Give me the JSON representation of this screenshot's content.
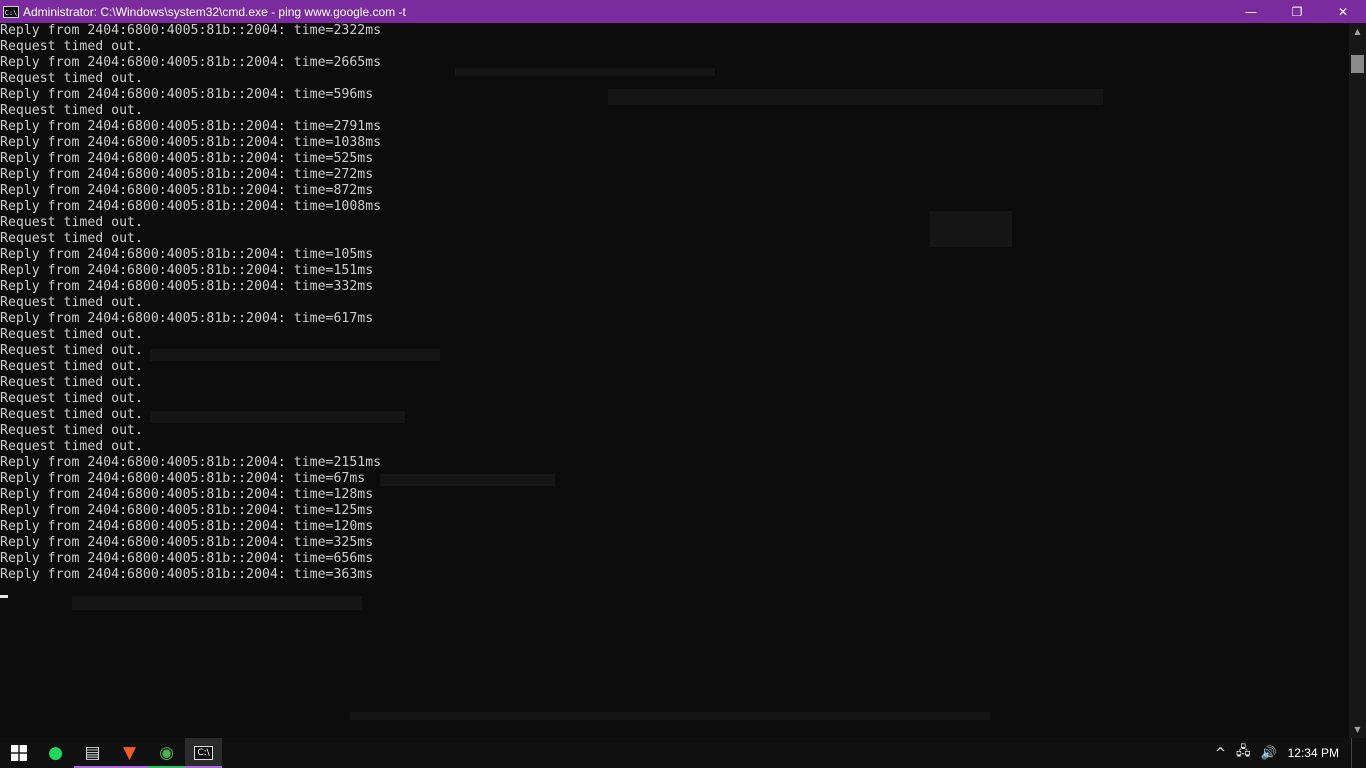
{
  "window": {
    "title": "Administrator: C:\\Windows\\system32\\cmd.exe - ping  www.google.com -t",
    "icon": "cmd-icon",
    "icon_glyph": "C:\\",
    "controls": {
      "minimize": "—",
      "restore": "❐",
      "close": "✕"
    }
  },
  "console": {
    "lines": [
      "Reply from 2404:6800:4005:81b::2004: time=2322ms",
      "Request timed out.",
      "Reply from 2404:6800:4005:81b::2004: time=2665ms",
      "Request timed out.",
      "Reply from 2404:6800:4005:81b::2004: time=596ms",
      "Request timed out.",
      "Reply from 2404:6800:4005:81b::2004: time=2791ms",
      "Reply from 2404:6800:4005:81b::2004: time=1038ms",
      "Reply from 2404:6800:4005:81b::2004: time=525ms",
      "Reply from 2404:6800:4005:81b::2004: time=272ms",
      "Reply from 2404:6800:4005:81b::2004: time=872ms",
      "Reply from 2404:6800:4005:81b::2004: time=1008ms",
      "Request timed out.",
      "Request timed out.",
      "Reply from 2404:6800:4005:81b::2004: time=105ms",
      "Reply from 2404:6800:4005:81b::2004: time=151ms",
      "Reply from 2404:6800:4005:81b::2004: time=332ms",
      "Request timed out.",
      "Reply from 2404:6800:4005:81b::2004: time=617ms",
      "Request timed out.",
      "Request timed out.",
      "Request timed out.",
      "Request timed out.",
      "Request timed out.",
      "Request timed out.",
      "Request timed out.",
      "Request timed out.",
      "Reply from 2404:6800:4005:81b::2004: time=2151ms",
      "Reply from 2404:6800:4005:81b::2004: time=67ms",
      "Reply from 2404:6800:4005:81b::2004: time=128ms",
      "Reply from 2404:6800:4005:81b::2004: time=125ms",
      "Reply from 2404:6800:4005:81b::2004: time=120ms",
      "Reply from 2404:6800:4005:81b::2004: time=325ms",
      "Reply from 2404:6800:4005:81b::2004: time=656ms",
      "Reply from 2404:6800:4005:81b::2004: time=363ms"
    ]
  },
  "scrollbar": {
    "up": "▲",
    "down": "▼"
  },
  "taskbar": {
    "start": "windows-icon",
    "apps": [
      {
        "name": "spotify-icon",
        "glyph": "●",
        "color": "#1ed760",
        "active": false,
        "running": false
      },
      {
        "name": "file-manager-icon",
        "glyph": "▤",
        "color": "#cfd8dc",
        "active": false,
        "running": true
      },
      {
        "name": "brave-browser-icon",
        "glyph": "▼",
        "color": "#f25a29",
        "active": false,
        "running": true
      },
      {
        "name": "chrome-icon",
        "glyph": "◉",
        "color": "#4caf50",
        "active": false,
        "running": true
      },
      {
        "name": "cmd-icon",
        "glyph": "C:\\",
        "color": "#ffffff",
        "active": true,
        "running": true
      }
    ],
    "tray": {
      "chevron": "^",
      "network": "🖧",
      "volume": "🔊",
      "clock": "12:34 PM"
    }
  },
  "colors": {
    "titlebar": "#7a2c9e",
    "console_bg": "#0c0c0c",
    "console_text": "#cccccc",
    "taskbar": "#101010"
  }
}
